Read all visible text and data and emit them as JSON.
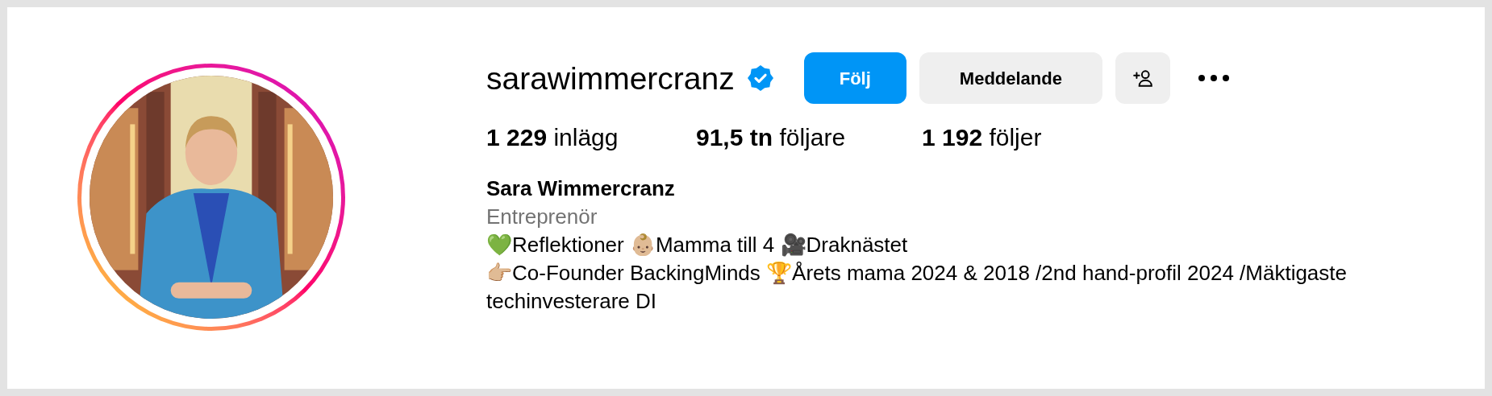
{
  "profile": {
    "username": "sarawimmercranz",
    "verified": true,
    "story_ring": true,
    "actions": [
      {
        "kind": "primary",
        "label": "Följ"
      },
      {
        "kind": "secondary",
        "label": "Meddelande"
      },
      {
        "kind": "suggest"
      },
      {
        "kind": "more"
      }
    ],
    "stats": [
      "**1 229** inlägg",
      "**91,5 tn** följare",
      "**1 192** följer"
    ],
    "name": "Sara Wimmercranz",
    "category": "Entreprenör",
    "bio": [
      "💚Reflektioner 👶🏼Mamma till 4 🎥Draknästet",
      "👉🏼Co-Founder BackingMinds 🏆Årets mama 2024 & 2018 /2nd hand-profil 2024 /Mäktigaste techinvesterare DI"
    ]
  }
}
